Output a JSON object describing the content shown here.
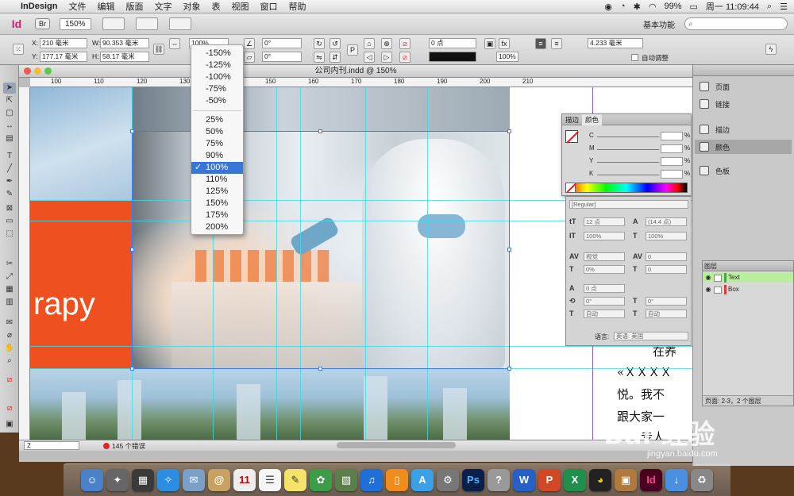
{
  "menubar": {
    "app_name": "InDesign",
    "items": [
      "文件",
      "编辑",
      "版面",
      "文字",
      "对象",
      "表",
      "视图",
      "窗口",
      "帮助"
    ],
    "battery": "99%",
    "clock": "周一 11:09:44"
  },
  "appbar": {
    "logo": "Id",
    "bridge": "Br",
    "zoom": "150%",
    "workspace": "基本功能"
  },
  "control": {
    "x": "210 毫米",
    "y": "177.17 毫米",
    "w": "90.353 毫米",
    "h": "58.17 毫米",
    "scale_x": "100%",
    "angle": "0°",
    "shear": "0°",
    "stroke": "0 点",
    "gap_value": "4.233 毫米",
    "opacity": "100%",
    "auto_fit_label": "自动调整",
    "x_label": "X:",
    "y_label": "Y:",
    "w_label": "W:",
    "h_label": "H:"
  },
  "document": {
    "title": "公司内刊.indd @ 150%",
    "ruler_marks": [
      "100",
      "110",
      "120",
      "130",
      "140",
      "150",
      "160",
      "170",
      "180",
      "190",
      "200",
      "210"
    ],
    "orange_text": "rapy",
    "chinese_lines": [
      "在养",
      "«ＸＸＸＸ",
      "悦。我不",
      "跟大家一",
      "专人"
    ],
    "status_page": "2",
    "status_errors": "145 个错误"
  },
  "zoom_menu": {
    "items": [
      "-150%",
      "-125%",
      "-100%",
      "-75%",
      "-50%",
      "25%",
      "50%",
      "75%",
      "90%",
      "100%",
      "110%",
      "125%",
      "150%",
      "175%",
      "200%"
    ],
    "selected": "100%",
    "check": "✓"
  },
  "color_panel": {
    "tab_stroke": "描边",
    "tab_color": "颜色",
    "channels": [
      "C",
      "M",
      "Y",
      "K"
    ],
    "percent": "%"
  },
  "character_panel": {
    "font_style": "[Regular]",
    "size": "12 点",
    "leading": "(14.4 点)",
    "vscale": "100%",
    "hscale": "100%",
    "kerning": "视觉",
    "tracking": "0",
    "tsume": "0%",
    "grid": "0",
    "baseline": "0 点",
    "rotate": "0°",
    "skew": "0°",
    "auto1": "自动",
    "auto2": "自动",
    "language_label": "语言:",
    "language": "英语: 美国"
  },
  "dock_panels": [
    "页面",
    "链接",
    "描边",
    "颜色",
    "色板"
  ],
  "layers_panel": {
    "title": "图层",
    "layers": [
      {
        "name": "Text",
        "color": "#4ea14a"
      },
      {
        "name": "Box",
        "color": "#e03a3a"
      }
    ],
    "footer": "页面: 2-3，2 个图层"
  },
  "watermark": {
    "brand": "Bai 经验",
    "url": "jingyan.baidu.com"
  },
  "colors": {
    "orange": "#ef5020",
    "guide": "#3dd9e6",
    "selection": "#3a7df0",
    "menu_highlight": "#3875d7"
  }
}
